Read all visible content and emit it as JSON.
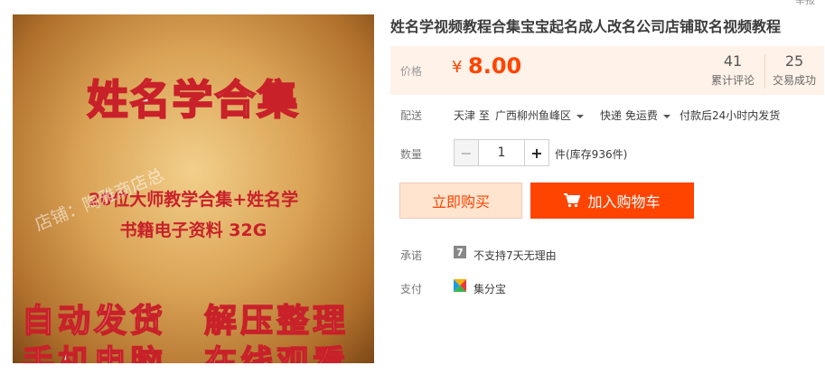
{
  "product_image": {
    "title": "姓名学合集",
    "line1": "20位大师教学合集+姓名学",
    "line2": "书籍电子资料 32G",
    "watermark": "店铺：陶雅商店总",
    "big_left_1": "自动发货",
    "big_right_1": "解压整理",
    "big_left_2": "手机电脑",
    "big_right_2": "在线观看"
  },
  "corner_text": "举报",
  "product_title": "姓名学视频教程合集宝宝起名成人改名公司店铺取名视频教程",
  "price": {
    "label": "价格",
    "symbol": "¥",
    "value": "8.00",
    "reviews_count": "41",
    "reviews_label": "累计评论",
    "trades_count": "25",
    "trades_label": "交易成功"
  },
  "shipping": {
    "label": "配送",
    "from": "天津 至",
    "to": "广西柳州鱼峰区",
    "method": "快递 免运费",
    "note": "付款后24小时内发货"
  },
  "quantity": {
    "label": "数量",
    "minus": "−",
    "value": "1",
    "plus": "+",
    "stock": "件(库存936件)"
  },
  "buttons": {
    "buy_now": "立即购买",
    "add_cart": "加入购物车"
  },
  "promise": {
    "label": "承诺",
    "icon_text": "7",
    "text": "不支持7天无理由"
  },
  "payment": {
    "label": "支付",
    "text": "集分宝"
  },
  "colors": {
    "accent": "#ff4400",
    "price_bg": "#fff2e8"
  }
}
